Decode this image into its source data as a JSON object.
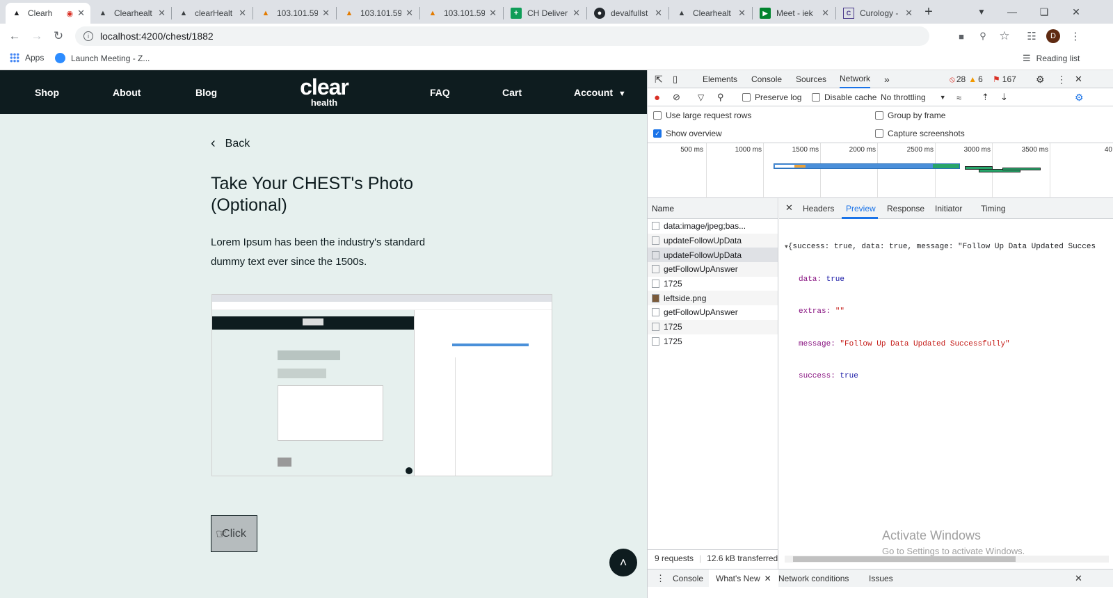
{
  "browser": {
    "tabs": [
      {
        "title": "Clearh",
        "favicon": "angular-icon",
        "active": true
      },
      {
        "title": "Clearhealt",
        "favicon": "angular-icon"
      },
      {
        "title": "clearHealt",
        "favicon": "angular-icon"
      },
      {
        "title": "103.101.59",
        "favicon": "phpmyadmin-icon"
      },
      {
        "title": "103.101.59",
        "favicon": "phpmyadmin-icon"
      },
      {
        "title": "103.101.59",
        "favicon": "phpmyadmin-icon"
      },
      {
        "title": "CH Deliver",
        "favicon": "sheets-icon"
      },
      {
        "title": "devalfullst",
        "favicon": "github-icon"
      },
      {
        "title": "Clearhealt",
        "favicon": "angular-icon"
      },
      {
        "title": "Meet - iek",
        "favicon": "meet-icon"
      },
      {
        "title": "Curology -",
        "favicon": "curology-icon"
      }
    ],
    "url": "localhost:4200/chest/1882",
    "profile_initial": "D",
    "bookmarks": {
      "apps": "Apps",
      "launch": "Launch Meeting - Z..."
    },
    "reading_list": "Reading list"
  },
  "site": {
    "nav": {
      "shop": "Shop",
      "about": "About",
      "blog": "Blog",
      "faq": "FAQ",
      "cart": "Cart",
      "account": "Account"
    },
    "logo": {
      "line1": "clear",
      "line2": "health"
    },
    "back": "Back",
    "title": "Take Your CHEST's Photo (Optional)",
    "paragraph": "Lorem Ipsum has been the industry's standard dummy text ever since the 1500s.",
    "click_label": "Click"
  },
  "devtools": {
    "tabs": {
      "elements": "Elements",
      "console": "Console",
      "sources": "Sources",
      "network": "Network"
    },
    "errors": "28",
    "warnings": "6",
    "issues": "167",
    "toolbar": {
      "preserve": "Preserve log",
      "disable_cache": "Disable cache",
      "throttling": "No throttling"
    },
    "options": {
      "large_rows": "Use large request rows",
      "group": "Group by frame",
      "overview": "Show overview",
      "screenshots": "Capture screenshots"
    },
    "timeline_ticks": [
      "500 ms",
      "1000 ms",
      "1500 ms",
      "2000 ms",
      "2500 ms",
      "3000 ms",
      "3500 ms",
      "40"
    ],
    "name_header": "Name",
    "requests": [
      "data:image/jpeg;bas...",
      "updateFollowUpData",
      "updateFollowUpData",
      "getFollowUpAnswer",
      "1725",
      "leftside.png",
      "getFollowUpAnswer",
      "1725",
      "1725"
    ],
    "detail_tabs": {
      "headers": "Headers",
      "preview": "Preview",
      "response": "Response",
      "initiator": "Initiator",
      "timing": "Timing"
    },
    "preview": {
      "summary": "{success: true, data: true, message: \"Follow Up Data Updated Succes",
      "data_key": "data: ",
      "data_val": "true",
      "extras_key": "extras: ",
      "extras_val": "\"\"",
      "message_key": "message: ",
      "message_val": "\"Follow Up Data Updated Successfully\"",
      "success_key": "success: ",
      "success_val": "true"
    },
    "status": {
      "requests": "9 requests",
      "transferred": "12.6 kB transferred"
    },
    "drawer": {
      "console": "Console",
      "whats_new": "What's New",
      "network_conditions": "Network conditions",
      "issues": "Issues"
    }
  },
  "watermark": {
    "line1": "Activate Windows",
    "line2": "Go to Settings to activate Windows."
  }
}
